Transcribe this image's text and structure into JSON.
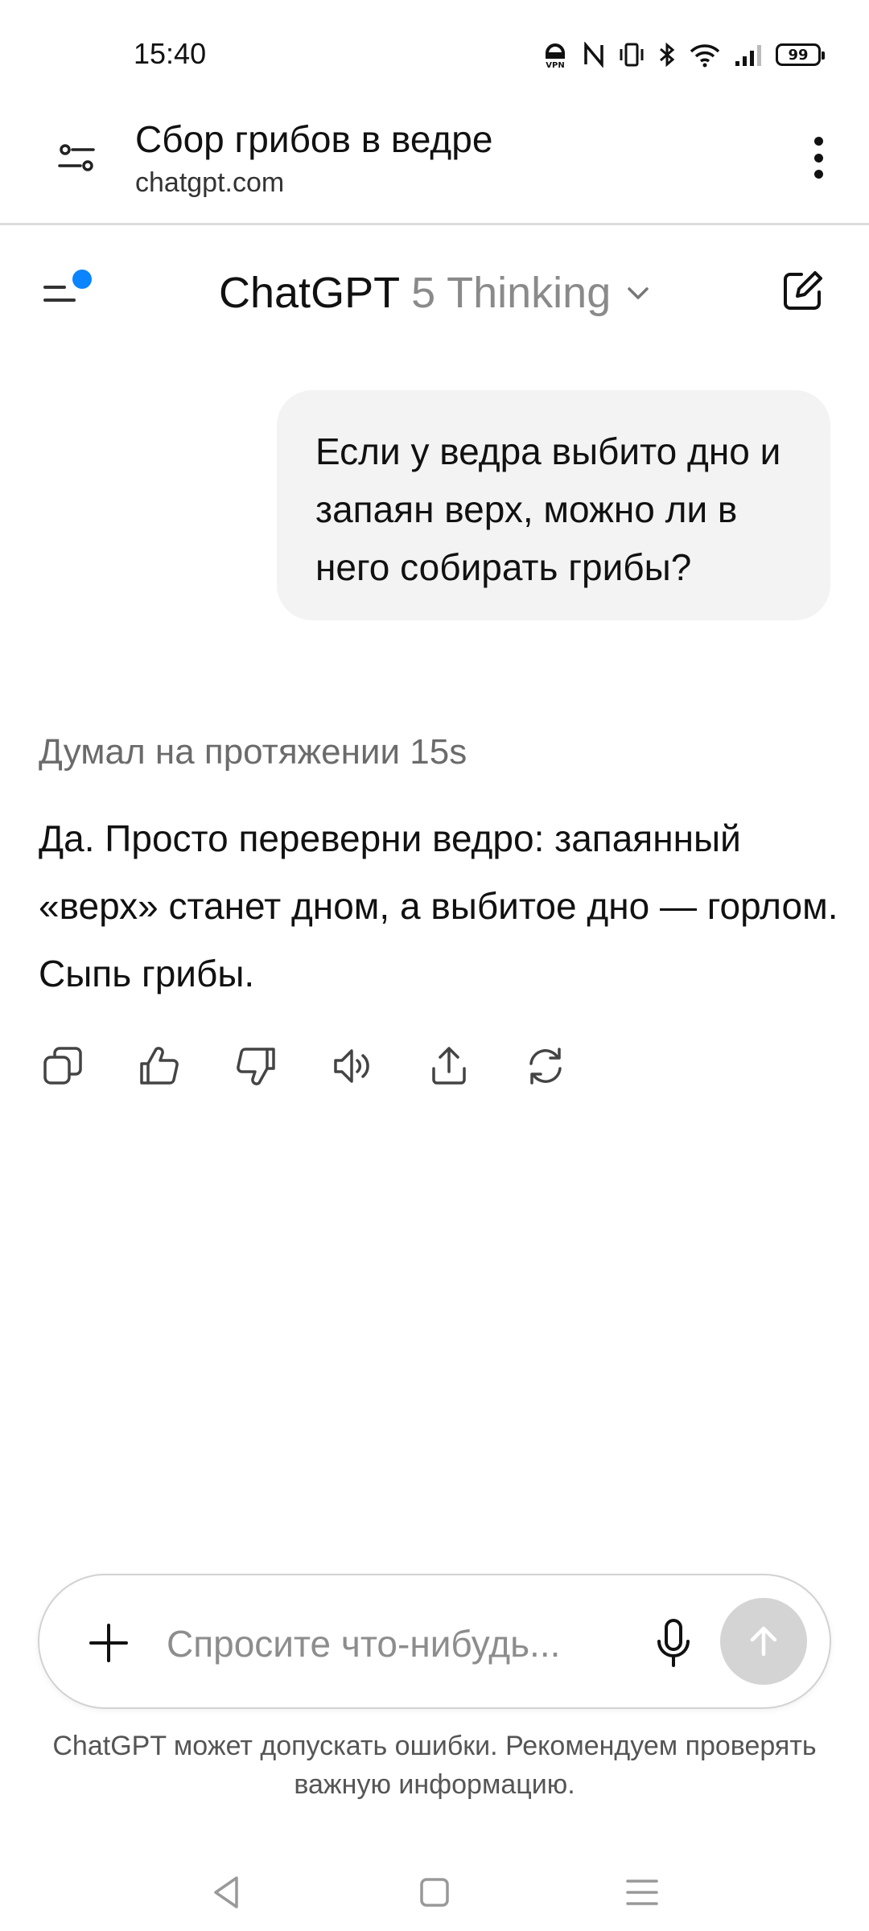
{
  "status_bar": {
    "time": "15:40",
    "battery": "99",
    "icons": [
      "vpn-icon",
      "nfc-icon",
      "vibrate-icon",
      "bluetooth-icon",
      "wifi-icon",
      "signal-icon",
      "battery-icon"
    ]
  },
  "browser": {
    "title": "Сбор грибов в ведре",
    "url": "chatgpt.com"
  },
  "header": {
    "app_name": "ChatGPT",
    "model": "5 Thinking",
    "notification_color": "#0a84ff"
  },
  "conversation": {
    "user_message": "Если у ведра выбито дно и запаян верх, можно ли в него собирать грибы?",
    "thought_label": "Думал на протяжении 15s",
    "assistant_message": "Да. Просто переверни ведро: запаянный «верх» станет дном, а выбитое дно — горлом. Сыпь грибы."
  },
  "actions": [
    "copy-icon",
    "thumbs-up-icon",
    "thumbs-down-icon",
    "read-aloud-icon",
    "share-icon",
    "regenerate-icon"
  ],
  "composer": {
    "placeholder": "Спросите что-нибудь...",
    "value": ""
  },
  "disclaimer": "ChatGPT может допускать ошибки. Рекомендуем проверять важную информацию.",
  "colors": {
    "bubble": "#f3f3f3",
    "send_button": "#d4d4d4",
    "muted_text": "#8a8a8a"
  }
}
